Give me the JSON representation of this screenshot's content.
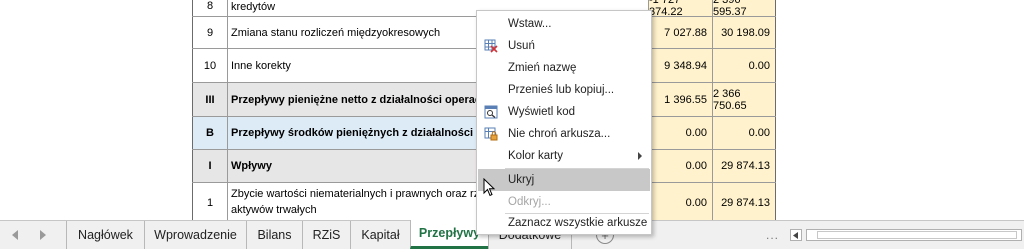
{
  "rows": [
    {
      "num": "8",
      "desc": "kredytów",
      "v1": "-1 727 374.22",
      "v2": "2 396 595.37",
      "style": "plain"
    },
    {
      "num": "9",
      "desc": "Zmiana stanu rozliczeń międzyokresowych",
      "v1": "7 027.88",
      "v2": "30 198.09",
      "style": "plain"
    },
    {
      "num": "10",
      "desc": "Inne korekty",
      "v1": "9 348.94",
      "v2": "0.00",
      "style": "plain"
    },
    {
      "num": "III",
      "desc": "Przepływy pieniężne netto z działalności operacyjnej",
      "v1": "1 396.55",
      "v2": "2 366 750.65",
      "style": "bold-grey"
    },
    {
      "num": "B",
      "desc": "Przepływy środków pieniężnych z działalności inwestycyjnej",
      "v1": "0.00",
      "v2": "0.00",
      "style": "bold-blue"
    },
    {
      "num": "I",
      "desc": "Wpływy",
      "v1": "0.00",
      "v2": "29 874.13",
      "style": "bold-grey"
    },
    {
      "num": "1",
      "desc": "Zbycie wartości niematerialnych i prawnych oraz rzeczowych aktywów trwałych",
      "v1": "0.00",
      "v2": "29 874.13",
      "style": "plain-multi"
    }
  ],
  "tabs": [
    {
      "label": "Nagłówek"
    },
    {
      "label": "Wprowadzenie"
    },
    {
      "label": "Bilans"
    },
    {
      "label": "RZiS"
    },
    {
      "label": "Kapitał"
    },
    {
      "label": "Przepływy",
      "active": true
    },
    {
      "label": "Dodatkowe"
    }
  ],
  "add_sheet_symbol": "+",
  "tab_overflow": "...",
  "context_menu": {
    "items": [
      {
        "label": "Wstaw...",
        "enabled": true,
        "icon": null
      },
      {
        "label": "Usuń",
        "enabled": true,
        "icon": "delete-sheet-icon"
      },
      {
        "label": "Zmień nazwę",
        "enabled": true,
        "icon": null
      },
      {
        "label": "Przenieś lub kopiuj...",
        "enabled": true,
        "icon": null
      },
      {
        "label": "Wyświetl kod",
        "enabled": true,
        "icon": "view-code-icon"
      },
      {
        "label": "Nie chroń arkusza...",
        "enabled": true,
        "icon": "unprotect-sheet-icon"
      },
      {
        "label": "Kolor karty",
        "enabled": true,
        "icon": null,
        "submenu": true
      },
      {
        "label": "Ukryj",
        "enabled": true,
        "icon": null,
        "hover": true
      },
      {
        "label": "Odkryj...",
        "enabled": false,
        "icon": null
      },
      {
        "label": "Zaznacz wszystkie arkusze",
        "enabled": true,
        "icon": null
      }
    ]
  },
  "colors": {
    "accent": "#217346",
    "value_fill": "#fff2cc",
    "section_grey": "#e7e6e6",
    "section_blue": "#ddebf7",
    "menu_hover": "#c8c8c8"
  }
}
